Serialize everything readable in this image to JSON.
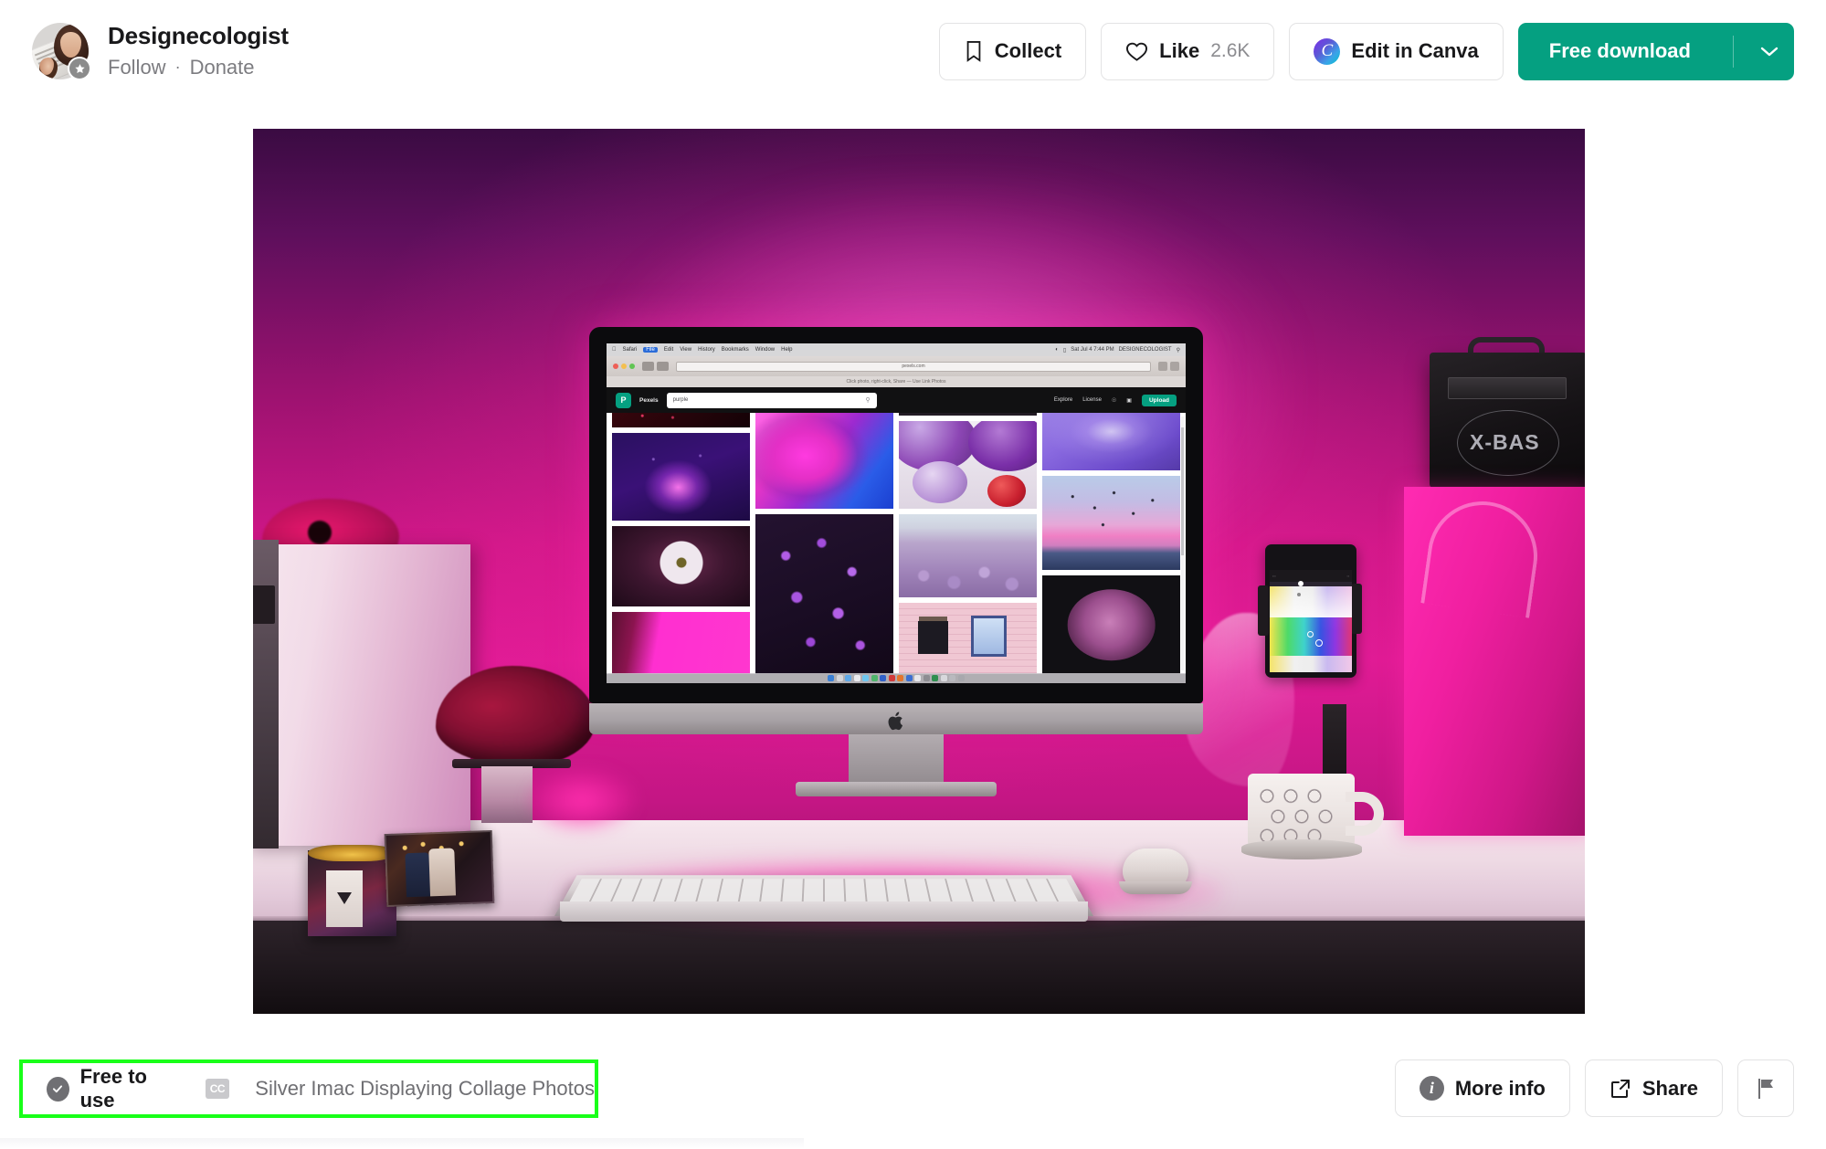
{
  "header": {
    "author_name": "Designecologist",
    "follow_label": "Follow",
    "separator": "·",
    "donate_label": "Donate",
    "avatar_alt": "avatar",
    "verified_icon": "star-badge-icon"
  },
  "actions": {
    "collect_label": "Collect",
    "collect_icon": "bookmark-icon",
    "like_label": "Like",
    "like_count": "2.6K",
    "like_icon": "heart-icon",
    "canva_label": "Edit in Canva",
    "canva_icon": "canva-icon",
    "canva_mark": "C",
    "download_label": "Free download",
    "download_caret_icon": "chevron-down-icon"
  },
  "photo": {
    "subject": "Silver iMac displaying a purple photo collage on a desk with pink LED lighting",
    "imac": {
      "menubar": {
        "apple": "",
        "items": [
          "Safari",
          "File",
          "Edit",
          "View",
          "History",
          "Bookmarks",
          "Window",
          "Help"
        ],
        "active_item": "File",
        "right_items": [
          "Wi-Fi",
          "Battery",
          "Search",
          "Control",
          "Sat Jul 4 7:44 PM",
          "DESIGNECOLOGIST"
        ]
      },
      "browser": {
        "url": "pexels.com",
        "bookmarks": "Click photo, right-click, Share — Use Link Photos"
      },
      "site": {
        "logo_letter": "P",
        "brand": "Pexels",
        "search_value": "purple",
        "search_icon": "search-icon",
        "nav": [
          "Explore",
          "License"
        ],
        "bell_icon": "bell-icon",
        "avatar_icon": "user-avatar-icon",
        "upload_label": "Upload"
      },
      "collage": {
        "columns": [
          [
            {
              "name": "dark-red-fireworks",
              "class": "t-fireworks-dark"
            },
            {
              "name": "purple-fiber-optic-fountain",
              "class": "t-fountain"
            },
            {
              "name": "white-daisy-flower",
              "class": "t-daisy"
            },
            {
              "name": "magenta-gradient",
              "class": "t-magenta"
            }
          ],
          [
            {
              "name": "pink-blue-smoke",
              "class": "t-smoke"
            },
            {
              "name": "purple-lilac-blossoms",
              "class": "t-lilac"
            }
          ],
          [
            {
              "name": "dark-strip",
              "class": "t-darkstrip"
            },
            {
              "name": "purple-balloons",
              "class": "t-balloons"
            },
            {
              "name": "lavender-field",
              "class": "t-lavfield"
            },
            {
              "name": "pink-wooden-house",
              "class": "t-pinkhouse"
            }
          ],
          [
            {
              "name": "purple-water-drop-ripple",
              "class": "t-waterdrop"
            },
            {
              "name": "birds-at-pink-sunset",
              "class": "t-birds"
            },
            {
              "name": "dark-purple-chrysanthemum",
              "class": "t-darkflower"
            }
          ]
        ]
      }
    },
    "objects": {
      "speaker_text": "X-BAS",
      "phone_app": "color picker",
      "mug": "white mug with line-art print",
      "candle": "glass candle",
      "frame": "framed photo of a couple"
    }
  },
  "footer": {
    "free_to_use": "Free to use",
    "free_icon": "check-circle-icon",
    "cc_badge": "CC",
    "photo_title": "Silver Imac Displaying Collage Photos",
    "more_info_label": "More info",
    "more_info_icon": "info-icon",
    "share_label": "Share",
    "share_icon": "external-link-icon",
    "report_icon": "flag-icon"
  },
  "colors": {
    "brand_green": "#05a081",
    "highlight_green": "#19ff19",
    "text_primary": "#19191b",
    "text_muted": "#7c7c80",
    "border": "#e3e3e4"
  }
}
